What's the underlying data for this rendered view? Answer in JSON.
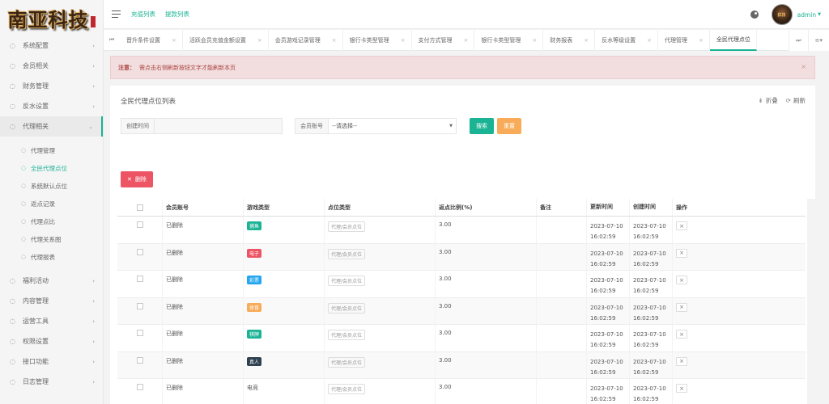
{
  "sidebar": {
    "logo_text": "南亚科技",
    "menu_top": [
      {
        "label": "系统配置",
        "icon": "circle-icon"
      },
      {
        "label": "会员相关",
        "icon": "circle-icon"
      },
      {
        "label": "财务管理",
        "icon": "circle-icon"
      },
      {
        "label": "反水设置",
        "icon": "circle-icon"
      },
      {
        "label": "代理相关",
        "icon": "circle-icon"
      }
    ],
    "submenu": [
      {
        "label": "代理管理"
      },
      {
        "label": "全民代理点位"
      },
      {
        "label": "系统默认点位"
      },
      {
        "label": "返点记录"
      },
      {
        "label": "代理点比"
      },
      {
        "label": "代理关系图"
      },
      {
        "label": "代理报表"
      }
    ],
    "menu_bottom": [
      {
        "label": "福利活动"
      },
      {
        "label": "内容管理"
      },
      {
        "label": "运营工具"
      },
      {
        "label": "权限设置"
      },
      {
        "label": "接口功能"
      },
      {
        "label": "日志管理"
      }
    ]
  },
  "topbar": {
    "links": [
      "充值列表",
      "提款列表"
    ],
    "admin": "admin",
    "avatar_text": "红日"
  },
  "tabs": [
    {
      "label": "晋升条件设置"
    },
    {
      "label": "活跃会员充值金额设置"
    },
    {
      "label": "会员游戏记录管理"
    },
    {
      "label": "银行卡类型管理"
    },
    {
      "label": "支付方式管理"
    },
    {
      "label": "银行卡类型管理"
    },
    {
      "label": "财务报表"
    },
    {
      "label": "反水等级设置"
    },
    {
      "label": "代理管理"
    },
    {
      "label": "全民代理点位"
    }
  ],
  "alert": {
    "strong": "注意：",
    "text": "需点击右侧刷新按钮文字才能刷新本页"
  },
  "panel": {
    "title": "全民代理点位列表",
    "collapse": "折叠",
    "refresh": "刷新"
  },
  "search": {
    "created_label": "创建时间",
    "member_label": "会员账号",
    "member_select": "--请选择--",
    "search_btn": "搜索",
    "reset_btn": "重置"
  },
  "delete_btn": "删除",
  "table": {
    "headers": [
      "会员账号",
      "游戏类型",
      "点位类型",
      "返点比例(%)",
      "备注",
      "更新时间",
      "创建时间",
      "操作"
    ],
    "rows": [
      {
        "account": "已删除",
        "game": "捕鱼",
        "game_color": "#1ab394",
        "ptype": "代理/会员点位",
        "ratio": "3.00",
        "note": "",
        "updated_1": "2023-07-10",
        "updated_2": "16:02:59",
        "created_1": "2023-07-10",
        "created_2": "16:02:59"
      },
      {
        "account": "已删除",
        "game": "电子",
        "game_color": "#ed5565",
        "ptype": "代理/会员点位",
        "ratio": "3.00",
        "note": "",
        "updated_1": "2023-07-10",
        "updated_2": "16:02:59",
        "created_1": "2023-07-10",
        "created_2": "16:02:59"
      },
      {
        "account": "已删除",
        "game": "彩票",
        "game_color": "#23a6f0",
        "ptype": "代理/会员点位",
        "ratio": "3.00",
        "note": "",
        "updated_1": "2023-07-10",
        "updated_2": "16:02:59",
        "created_1": "2023-07-10",
        "created_2": "16:02:59"
      },
      {
        "account": "已删除",
        "game": "体育",
        "game_color": "#f8ac59",
        "ptype": "代理/会员点位",
        "ratio": "3.00",
        "note": "",
        "updated_1": "2023-07-10",
        "updated_2": "16:02:59",
        "created_1": "2023-07-10",
        "created_2": "16:02:59"
      },
      {
        "account": "已删除",
        "game": "棋牌",
        "game_color": "#1ab394",
        "ptype": "代理/会员点位",
        "ratio": "3.00",
        "note": "",
        "updated_1": "2023-07-10",
        "updated_2": "16:02:59",
        "created_1": "2023-07-10",
        "created_2": "16:02:59"
      },
      {
        "account": "已删除",
        "game": "真人",
        "game_color": "#2f4050",
        "ptype": "代理/会员点位",
        "ratio": "3.00",
        "note": "",
        "updated_1": "2023-07-10",
        "updated_2": "16:02:59",
        "created_1": "2023-07-10",
        "created_2": "16:02:59"
      },
      {
        "account": "已删除",
        "game": "电竞",
        "game_color": "",
        "ptype": "代理/会员点位",
        "ratio": "3.00",
        "note": "",
        "updated_1": "2023-07-10",
        "updated_2": "16:02:59",
        "created_1": "2023-07-10",
        "created_2": "16:02:59"
      }
    ]
  },
  "colors": {
    "accent": "#1ab394",
    "danger": "#ed5565",
    "warning": "#f8ac59"
  }
}
